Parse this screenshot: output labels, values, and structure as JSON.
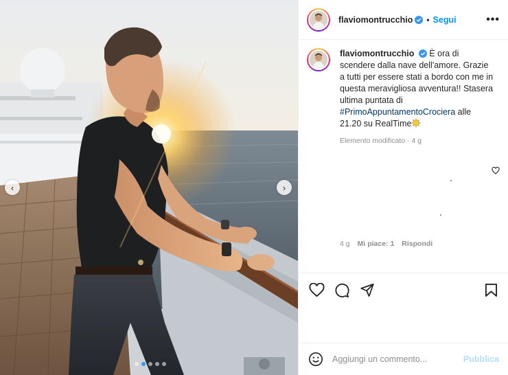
{
  "post": {
    "carousel": {
      "slide_count": 5,
      "active_slide": 2
    },
    "author": {
      "username": "flaviomontrucchio",
      "verified": true
    },
    "follow_label": "Segui",
    "separator": "•",
    "more_label": "•••"
  },
  "caption": {
    "username": "flaviomontrucchio",
    "text_part1": "È ora di scendere dalla nave dell'amore. Grazie a tutti per essere stati a bordo con me in questa meravigliosa avventura!! Stasera ultima puntata di",
    "hashtag": "#PrimoAppuntamentoCrociera",
    "text_part2": "alle 21.20 su RealTime",
    "edit_meta": "Elemento modificato · 4 g"
  },
  "reply_meta": {
    "time": "4 g",
    "likes": "Mi piace: 1",
    "reply": "Rispondi"
  },
  "comment_box": {
    "placeholder": "Aggiungi un commento...",
    "publish_label": "Pubblica"
  },
  "icons": {
    "prev": "chevron-left-icon",
    "next": "chevron-right-icon",
    "like": "heart-icon",
    "comment": "comment-icon",
    "share": "send-icon",
    "save": "bookmark-icon",
    "emoji": "emoji-icon",
    "verified": "verified-badge-icon",
    "sun_emoji": "sun-emoji"
  },
  "colors": {
    "link_blue": "#0095f6",
    "hashtag_blue": "#00376b",
    "muted": "#8e8e8e",
    "publish_disabled": "#b2dffc"
  }
}
